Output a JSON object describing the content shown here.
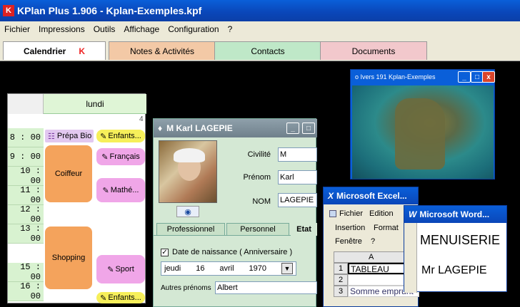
{
  "app": {
    "title": "KPlan Plus 1.906 - Kplan-Exemples.kpf"
  },
  "menu": [
    "Fichier",
    "Impressions",
    "Outils",
    "Affichage",
    "Configuration",
    "?"
  ],
  "tabs": [
    "Calendrier",
    "Notes & Activités",
    "Contacts",
    "Documents"
  ],
  "calendar": {
    "day": "lundi",
    "day_number": "4",
    "hours": [
      "8 : 00",
      "9 : 00",
      "10 : 00",
      "11 : 00",
      "12 : 00",
      "13 : 00",
      "15 : 00",
      "16 : 00"
    ],
    "events": [
      "Prépa Bio",
      "Enfants...",
      "Coiffeur",
      "Français",
      "Mathé...",
      "Shopping",
      "Sport",
      "Enfants..."
    ]
  },
  "photo_window": {
    "title": "o Ivers 191 Kplan-Exemples"
  },
  "contact_window": {
    "title": "M Karl LAGEPIE",
    "labels": {
      "civilite": "Civilité",
      "prenom": "Prénom",
      "nom": "NOM"
    },
    "values": {
      "civilite": "M",
      "prenom": "Karl",
      "nom": "LAGEPIE"
    },
    "subtabs": [
      "Professionnel",
      "Personnel",
      "Etat"
    ],
    "birth_label": "Date de naissance ( Anniversaire )",
    "birth_date": {
      "weekday": "jeudi",
      "day": "16",
      "month": "avril",
      "year": "1970"
    },
    "other_names_label": "Autres prénoms",
    "other_names_value": "Albert"
  },
  "excel_window": {
    "title": "Microsoft Excel...",
    "menu": [
      "Fichier",
      "Edition",
      "Insertion",
      "Format",
      "Fenêtre",
      "?"
    ],
    "col": "A",
    "rows": [
      "1",
      "2",
      "3"
    ],
    "cells": [
      "TABLEAU",
      "",
      "Somme emprunt"
    ]
  },
  "word_window": {
    "title": "Microsoft Word...",
    "lines": [
      "MENUISERIE",
      "Mr LAGEPIE"
    ]
  }
}
